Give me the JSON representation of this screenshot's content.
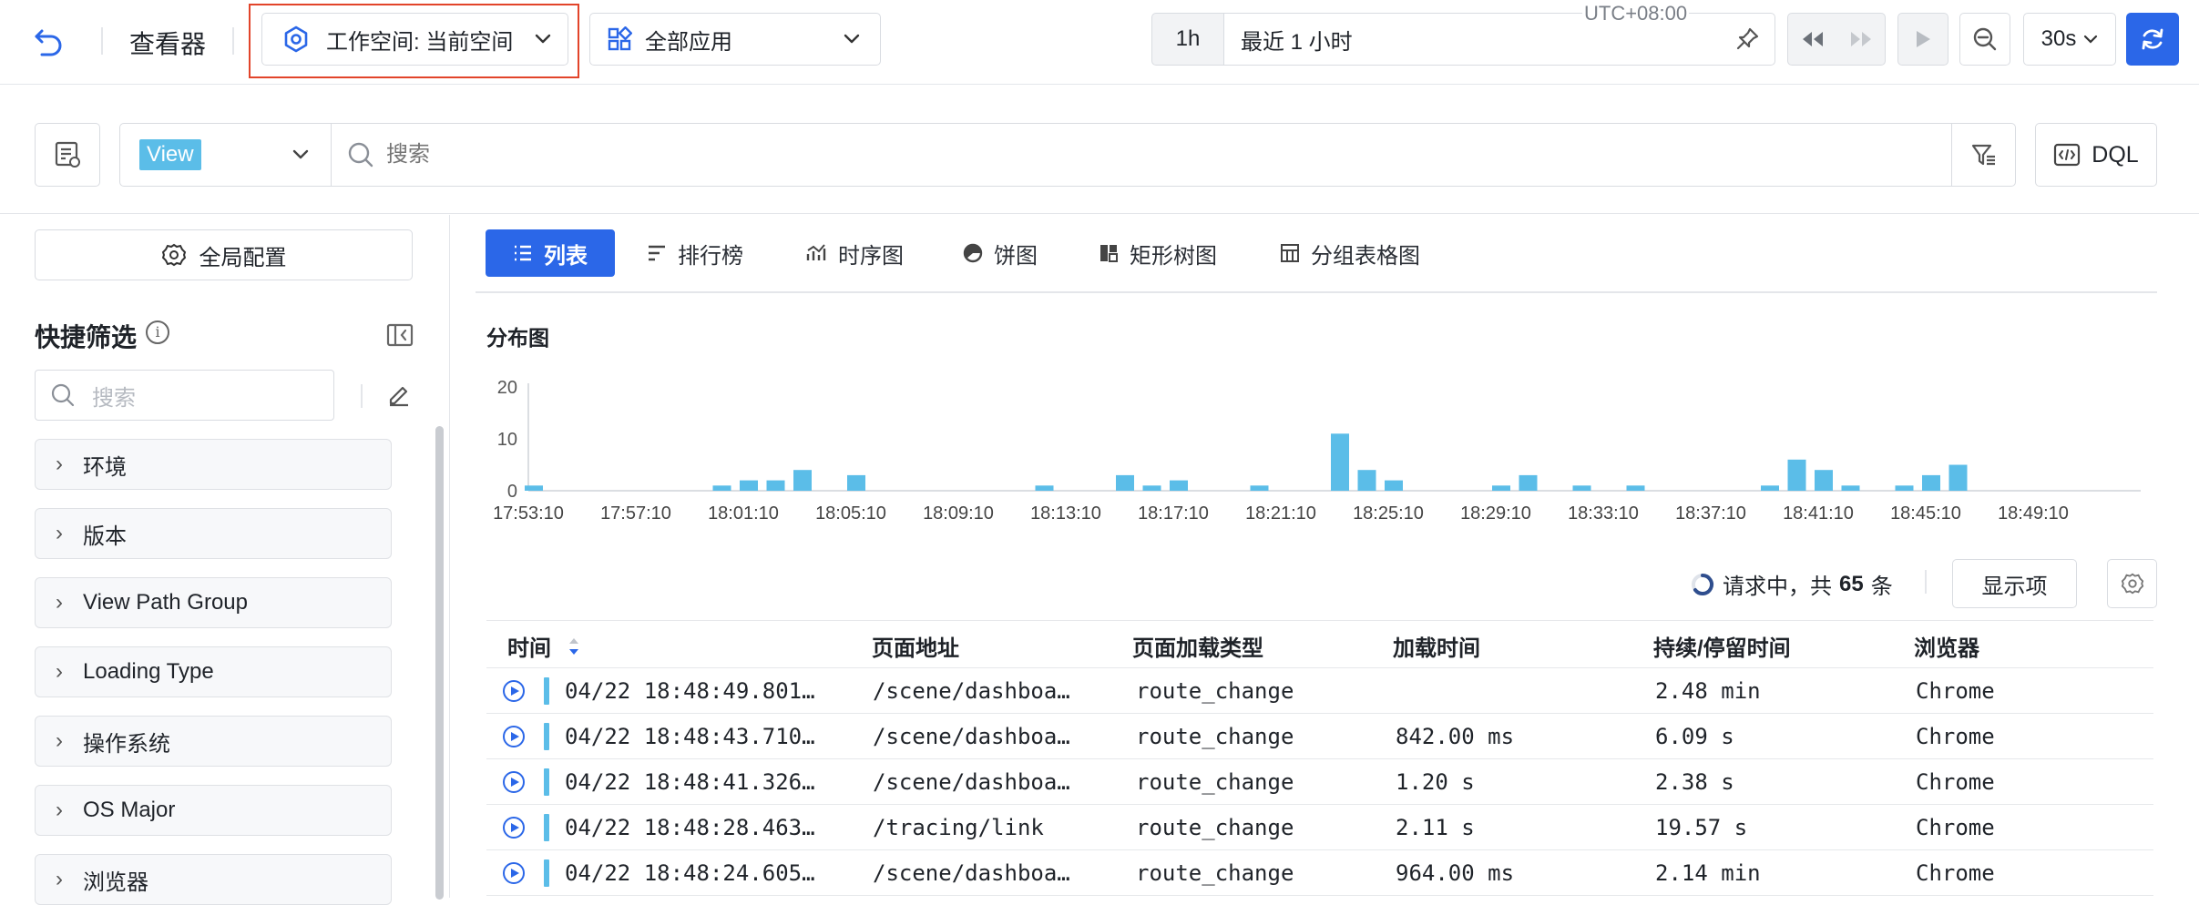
{
  "topbar": {
    "viewer_title": "查看器",
    "workspace_label": "工作空间: 当前空间",
    "app_label": "全部应用",
    "timezone": "UTC+08:00",
    "time_shortcut": "1h",
    "time_range": "最近 1 小时",
    "refresh_interval": "30s",
    "accent_color": "#2b67e8",
    "highlight_color": "#e2442a"
  },
  "search": {
    "source": "View",
    "placeholder": "搜索",
    "dql_label": "DQL"
  },
  "sidebar": {
    "global_config_label": "全局配置",
    "quick_filter_title": "快捷筛选",
    "search_placeholder": "搜索",
    "items": [
      {
        "label": "环境"
      },
      {
        "label": "版本"
      },
      {
        "label": "View Path Group"
      },
      {
        "label": "Loading Type"
      },
      {
        "label": "操作系统"
      },
      {
        "label": "OS Major"
      },
      {
        "label": "浏览器"
      }
    ]
  },
  "tabs": [
    {
      "label": "列表",
      "active": true,
      "icon": "list-icon"
    },
    {
      "label": "排行榜",
      "active": false,
      "icon": "ranking-icon"
    },
    {
      "label": "时序图",
      "active": false,
      "icon": "timeseries-icon"
    },
    {
      "label": "饼图",
      "active": false,
      "icon": "pie-icon"
    },
    {
      "label": "矩形树图",
      "active": false,
      "icon": "treemap-icon"
    },
    {
      "label": "分组表格图",
      "active": false,
      "icon": "group-table-icon"
    }
  ],
  "chart_data": {
    "type": "bar",
    "title": "分布图",
    "color": "#5bbde8",
    "ylim": [
      0,
      20
    ],
    "yticks": [
      0,
      10,
      20
    ],
    "xticks": [
      "17:53:10",
      "17:57:10",
      "18:01:10",
      "18:05:10",
      "18:09:10",
      "18:13:10",
      "18:17:10",
      "18:21:10",
      "18:25:10",
      "18:29:10",
      "18:33:10",
      "18:37:10",
      "18:41:10",
      "18:45:10",
      "18:49:10"
    ],
    "x": [
      "17:53:10",
      "18:00:10",
      "18:01:10",
      "18:02:10",
      "18:03:10",
      "18:05:10",
      "18:12:10",
      "18:15:10",
      "18:16:10",
      "18:17:10",
      "18:20:10",
      "18:23:10",
      "18:24:10",
      "18:25:10",
      "18:29:10",
      "18:30:10",
      "18:32:10",
      "18:34:10",
      "18:39:10",
      "18:40:10",
      "18:41:10",
      "18:42:10",
      "18:44:10",
      "18:45:10",
      "18:46:10"
    ],
    "values": [
      1,
      1,
      2,
      2,
      4,
      3,
      1,
      3,
      1,
      2,
      1,
      11,
      4,
      2,
      1,
      3,
      1,
      1,
      1,
      6,
      4,
      1,
      1,
      3,
      5
    ]
  },
  "table_toolbar": {
    "status_prefix": "请求中，共",
    "count": "65",
    "status_suffix": "条",
    "display_items_label": "显示项"
  },
  "table": {
    "columns": [
      "时间",
      "页面地址",
      "页面加载类型",
      "加载时间",
      "持续/停留时间",
      "浏览器"
    ],
    "rows": [
      {
        "time": "04/22 18:48:49.801…",
        "url": "/scene/dashboa…",
        "type": "route_change",
        "load": "",
        "duration": "2.48 min",
        "browser": "Chrome"
      },
      {
        "time": "04/22 18:48:43.710…",
        "url": "/scene/dashboa…",
        "type": "route_change",
        "load": "842.00 ms",
        "duration": "6.09 s",
        "browser": "Chrome"
      },
      {
        "time": "04/22 18:48:41.326…",
        "url": "/scene/dashboa…",
        "type": "route_change",
        "load": "1.20 s",
        "duration": "2.38 s",
        "browser": "Chrome"
      },
      {
        "time": "04/22 18:48:28.463…",
        "url": "/tracing/link",
        "type": "route_change",
        "load": "2.11 s",
        "duration": "19.57 s",
        "browser": "Chrome"
      },
      {
        "time": "04/22 18:48:24.605…",
        "url": "/scene/dashboa…",
        "type": "route_change",
        "load": "964.00 ms",
        "duration": "2.14 min",
        "browser": "Chrome"
      }
    ]
  }
}
